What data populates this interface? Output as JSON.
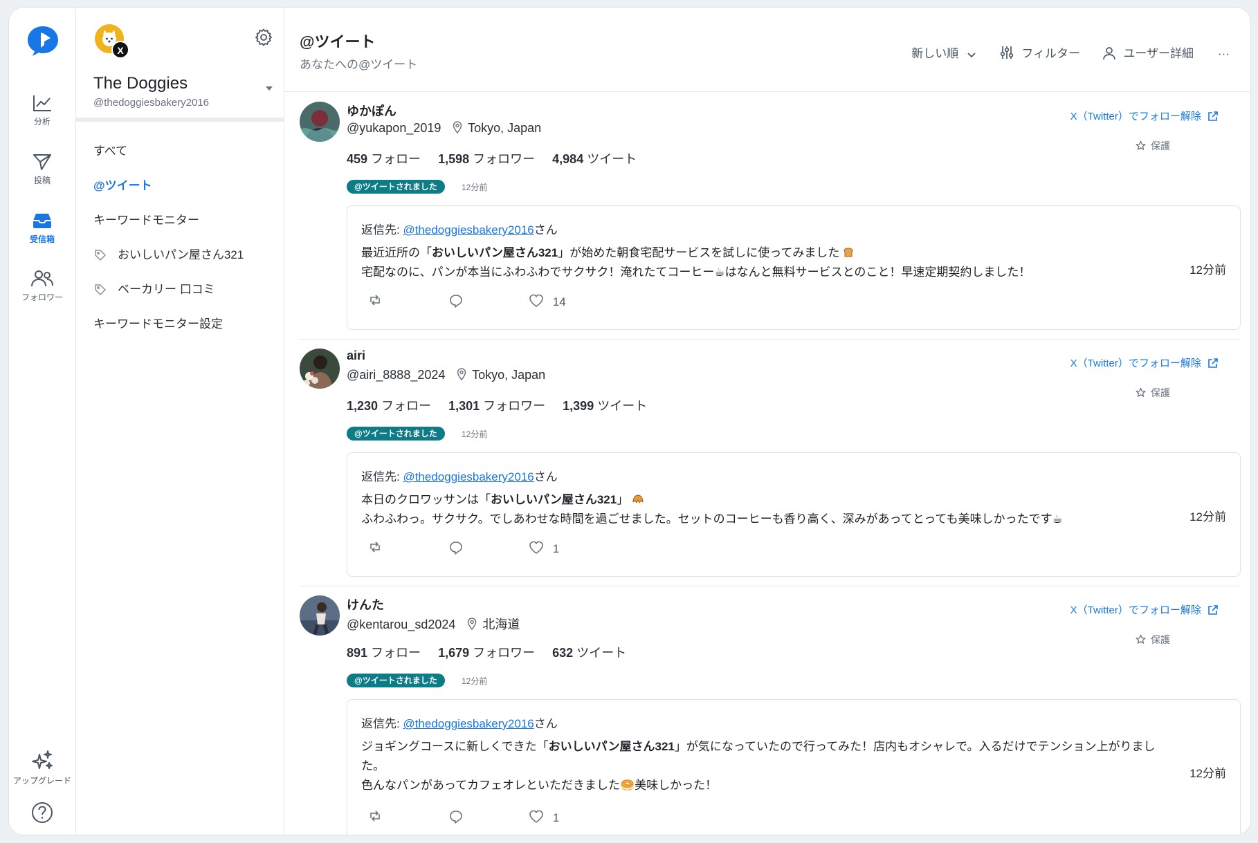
{
  "rail": {
    "items": [
      {
        "label": "分析",
        "icon": "chart-line-icon"
      },
      {
        "label": "投稿",
        "icon": "send-icon"
      },
      {
        "label": "受信箱",
        "icon": "inbox-icon"
      },
      {
        "label": "フォロワー",
        "icon": "followers-icon"
      }
    ],
    "upgrade_label": "アップグレード",
    "help_icon": "help-icon"
  },
  "account": {
    "name": "The Doggies",
    "handle": "@thedoggiesbakery2016",
    "x_badge": "X"
  },
  "nav": {
    "items": [
      {
        "label": "すべて",
        "active": false,
        "tag": false
      },
      {
        "label": "@ツイート",
        "active": true,
        "tag": false
      },
      {
        "label": "キーワードモニター",
        "active": false,
        "tag": false
      },
      {
        "label": "おいしいパン屋さん321",
        "active": false,
        "tag": true
      },
      {
        "label": "ベーカリー 口コミ",
        "active": false,
        "tag": true
      },
      {
        "label": "キーワードモニター設定",
        "active": false,
        "tag": false
      }
    ]
  },
  "header": {
    "title": "@ツイート",
    "subtitle": "あなたへの@ツイート",
    "sort_label": "新しい順",
    "filter_label": "フィルター",
    "user_detail_label": "ユーザー詳細",
    "more_label": "···"
  },
  "common": {
    "unfollow_label": "X（Twitter）でフォロー解除",
    "protect_label": "保護",
    "badge_label": "@ツイートされました",
    "reply_prefix": "返信先: ",
    "reply_handle": "@thedoggiesbakery2016",
    "reply_suffix": "さん",
    "following_suffix": " フォロー",
    "followers_suffix": " フォロワー",
    "tweets_suffix": " ツイート"
  },
  "tweets": [
    {
      "name": "ゆかぽん",
      "handle": "@yukapon_2019",
      "location": "Tokyo, Japan",
      "following": "459",
      "followers": "1,598",
      "tweet_count": "4,984",
      "badge_time": "12分前",
      "line1_pre": "最近近所の「",
      "line1_bold": "おいしいパン屋さん321",
      "line1_post": "」が始めた朝食宅配サービスを試しに使ってみました",
      "line1_emoji": "bread",
      "line2": "宅配なのに、パンが本当にふわふわでサクサク！淹れたてコーヒー☕はなんと無料サービスとのこと！早速定期契約しました！",
      "line3": "",
      "time": "12分前",
      "likes": "14"
    },
    {
      "name": "airi",
      "handle": "@airi_8888_2024",
      "location": "Tokyo, Japan",
      "following": "1,230",
      "followers": "1,301",
      "tweet_count": "1,399",
      "badge_time": "12分前",
      "line1_pre": "本日のクロワッサンは「",
      "line1_bold": "おいしいパン屋さん321",
      "line1_post": "」",
      "line1_emoji": "croissant",
      "line2": "ふわふわっ。サクサク。でしあわせな時間を過ごせました。セットのコーヒーも香り高く、深みがあってとっても美味しかったです☕",
      "line3": "",
      "time": "12分前",
      "likes": "1"
    },
    {
      "name": "けんた",
      "handle": "@kentarou_sd2024",
      "location": "北海道",
      "following": "891",
      "followers": "1,679",
      "tweet_count": "632",
      "badge_time": "12分前",
      "line1_pre": "ジョギングコースに新しくできた「",
      "line1_bold": "おいしいパン屋さん321",
      "line1_post": "」が気になっていたので行ってみた！店内もオシャレで。入るだけでテンション上がりました。",
      "line1_emoji": "",
      "line2": "",
      "line3": "色んなパンがあってカフェオレといただきました🥯美味しかった！",
      "time": "12分前",
      "likes": "1"
    }
  ],
  "colors": {
    "accent": "#1877e6",
    "badge": "#0e7c86",
    "logo": "#1877e6",
    "account_avatar": "#f2b21b"
  }
}
